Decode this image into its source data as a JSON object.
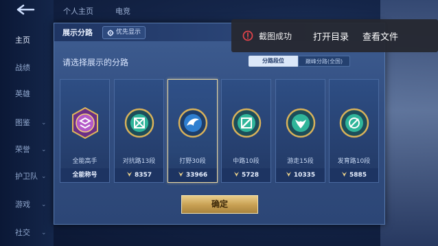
{
  "sidebar": {
    "items": [
      {
        "label": "主页",
        "chev": ""
      },
      {
        "label": "战绩",
        "chev": ""
      },
      {
        "label": "英雄",
        "chev": ""
      },
      {
        "label": "图鉴",
        "chev": "⌄"
      },
      {
        "label": "荣誉",
        "chev": "⌄"
      },
      {
        "label": "护卫队",
        "chev": "⌄"
      },
      {
        "label": "游戏",
        "chev": "⌄"
      },
      {
        "label": "社交",
        "chev": "⌄"
      }
    ]
  },
  "top_tabs": [
    "个人主页",
    "电竞"
  ],
  "dialog": {
    "title": "展示分路",
    "priority_label": "优先显示",
    "prompt": "请选择展示的分路",
    "segments": {
      "active": "分路段位",
      "inactive": "巅峰分路(全国)"
    },
    "cards": [
      {
        "name": "全能高手",
        "foot": "全能称号",
        "has_points": false,
        "selected": false,
        "ring": "#b45ac8"
      },
      {
        "name": "对抗路13段",
        "foot": "8357",
        "has_points": true,
        "selected": false,
        "ring": "#2fb59a"
      },
      {
        "name": "打野30段",
        "foot": "33966",
        "has_points": true,
        "selected": true,
        "ring": "#2f7fd0"
      },
      {
        "name": "中路10段",
        "foot": "5728",
        "has_points": true,
        "selected": false,
        "ring": "#2fb59a"
      },
      {
        "name": "游走15段",
        "foot": "10335",
        "has_points": true,
        "selected": false,
        "ring": "#2fb59a"
      },
      {
        "name": "发育路10段",
        "foot": "5885",
        "has_points": true,
        "selected": false,
        "ring": "#2fb59a"
      }
    ],
    "confirm_label": "确定"
  },
  "toast": {
    "message": "截图成功",
    "open_dir": "打开目录",
    "view_file": "查看文件"
  },
  "icons": {
    "back": "back-arrow-icon",
    "gear": "gear-icon",
    "points": "points-icon",
    "toast": "error-circle-icon"
  },
  "colors": {
    "accent_gold": "#c79f52",
    "selected_border": "#e9d8a4",
    "toast_bg": "#26282e",
    "toast_icon": "#e0434a"
  }
}
